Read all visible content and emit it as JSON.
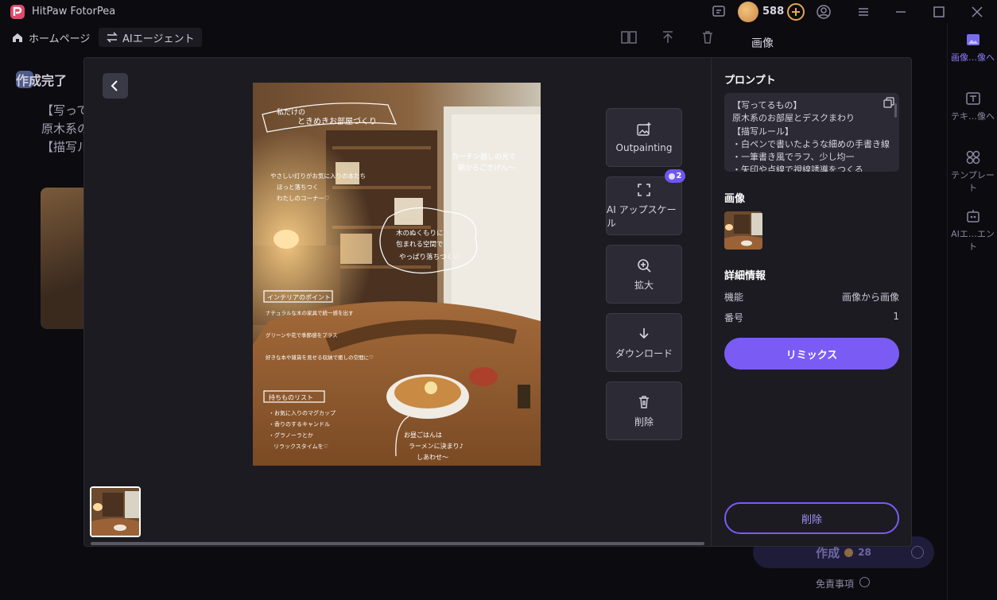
{
  "app": {
    "title": "HitPaw FotorPea",
    "credits": "588"
  },
  "nav": {
    "home": "ホームページ",
    "agent": "AIエージェント"
  },
  "background": {
    "left_title": "作成完了",
    "left_lines": [
      "【写ってる",
      "原木系の",
      "【描写ル"
    ],
    "right_title": "画像",
    "rail": [
      "画像…像へ",
      "テキ…像へ",
      "テンプレート",
      "AIエ…エント"
    ],
    "create_label": "作成",
    "create_cost": "28",
    "disclaimer": "免責事項"
  },
  "tools": {
    "outpainting": "Outpainting",
    "upscale": "AI アップスケール",
    "upscale_cost": "2",
    "zoom": "拡大",
    "download": "ダウンロード",
    "delete": "削除"
  },
  "details": {
    "prompt_title": "プロンプト",
    "prompt_lines": [
      "【写ってるもの】",
      "原木系のお部屋とデスクまわり",
      "【描写ルール】",
      "・白ペンで書いたような細めの手書き線",
      "・一筆書き風でラフ、少し均一",
      "・矢印や点線で視線誘導をつくる"
    ],
    "image_title": "画像",
    "info_title": "詳細情報",
    "info": [
      {
        "key": "機能",
        "value": "画像から画像"
      },
      {
        "key": "番号",
        "value": "1"
      }
    ],
    "remix_label": "リミックス",
    "delete_label": "削除"
  },
  "image_annotations": {
    "banner_line1": "私だけの",
    "banner_line2": "ときめきお部屋づくり",
    "curtain_line1": "カーテン越しの光で",
    "curtain_line2": "朝からごきげん〜",
    "left_note": [
      "やさしい灯りがお気に入りの本たち",
      "ほっと落ちつく",
      "わたしのコーナー♡"
    ],
    "cloud_note": [
      "木のぬくもりに",
      "包まれる空間で",
      "やっぱり落ちつく♡"
    ],
    "points_title": "インテリアのポイント",
    "points": [
      "ナチュラルな木の家具で統一感を出す",
      "グリーンや花で季節感をプラス",
      "好きな本や雑貨を見せる収納で癒しの空間に♡"
    ],
    "list_title": "持ちものリスト",
    "list": [
      "・お気に入りのマグカップ",
      "・香りのするキャンドル",
      "・グラノーラとか",
      "リラックスタイムを♡"
    ],
    "lunch_note": [
      "お昼ごはんは",
      "ラーメンに決まり♪",
      "しあわせ〜"
    ]
  },
  "colors": {
    "accent": "#7a5cf5",
    "modal_bg": "#1c1b22",
    "button_bg": "#2c2b35"
  }
}
